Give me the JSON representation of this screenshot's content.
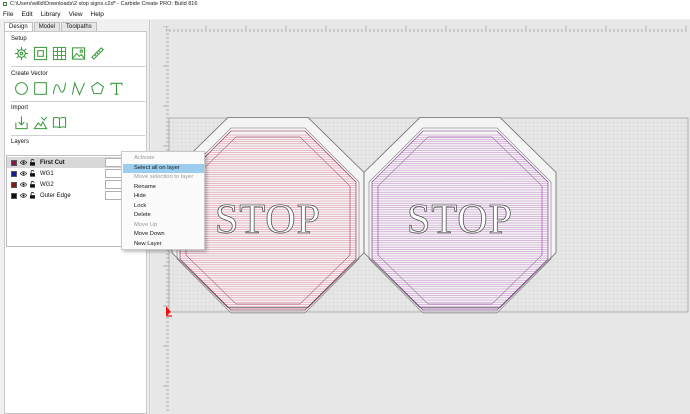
{
  "window": {
    "title": "C:\\Users\\willd\\Downloads\\2 stop signs.c2d* - Carbide Create PRO: Build 816"
  },
  "menu": [
    "File",
    "Edit",
    "Library",
    "View",
    "Help"
  ],
  "tabs": [
    {
      "label": "Design",
      "active": true
    },
    {
      "label": "Model",
      "active": false
    },
    {
      "label": "Toolpaths",
      "active": false
    }
  ],
  "sections": {
    "setup": "Setup",
    "create_vector": "Create Vector",
    "import": "Import",
    "layers": "Layers"
  },
  "setup_icons": [
    "job-setup-icon",
    "node-select-icon",
    "grid-icon",
    "image-icon",
    "measure-icon"
  ],
  "vector_icons": [
    "circle-icon",
    "rectangle-icon",
    "curve-icon",
    "polyline-icon",
    "polygon-icon",
    "text-icon"
  ],
  "import_icons": [
    "import-file-icon",
    "trace-image-icon",
    "book-icon"
  ],
  "layers": [
    {
      "name": "First Cut",
      "color": "#7a1a4a",
      "selected": true,
      "bold": true
    },
    {
      "name": "WG1",
      "color": "#1a1a8a",
      "selected": false,
      "bold": false
    },
    {
      "name": "WG2",
      "color": "#8a1a1a",
      "selected": false,
      "bold": false
    },
    {
      "name": "Outer Edge",
      "color": "#111111",
      "selected": false,
      "bold": false
    }
  ],
  "context_menu": [
    {
      "label": "Activate",
      "disabled": true,
      "highlighted": false
    },
    {
      "label": "Select all on layer",
      "disabled": false,
      "highlighted": true
    },
    {
      "label": "Move selection to layer",
      "disabled": true,
      "highlighted": false
    },
    {
      "label": "Rename",
      "disabled": false,
      "highlighted": false
    },
    {
      "label": "Hide",
      "disabled": false,
      "highlighted": false
    },
    {
      "label": "Lock",
      "disabled": false,
      "highlighted": false
    },
    {
      "label": "Delete",
      "disabled": false,
      "highlighted": false
    },
    {
      "label": "Move Up",
      "disabled": true,
      "highlighted": false
    },
    {
      "label": "Move Down",
      "disabled": false,
      "highlighted": false
    },
    {
      "label": "New Layer",
      "disabled": false,
      "highlighted": false
    }
  ],
  "signs": [
    {
      "text": "STOP",
      "line_color": "#d14a6a"
    },
    {
      "text": "STOP",
      "line_color": "#a04aa8"
    }
  ],
  "colors": {
    "accent": "#3a9a3a",
    "highlight": "#9ccdef",
    "grid": "#c9c9c9",
    "origin": "#e11"
  }
}
